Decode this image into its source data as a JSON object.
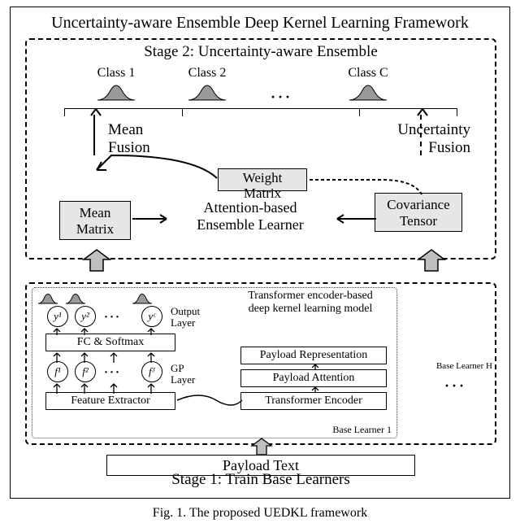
{
  "title": "Uncertainty-aware Ensemble Deep Kernel Learning Framework",
  "stage2": {
    "title": "Stage 2: Uncertainty-aware Ensemble",
    "classes": {
      "c1": "Class 1",
      "c2": "Class 2",
      "cC": "Class C",
      "dots": "···"
    },
    "mean_fusion": "Mean\nFusion",
    "uncertainty_fusion": "Uncertainty\nFusion",
    "weight_matrix_l1": "Weight",
    "weight_matrix_l2": "Matrix",
    "mean_matrix_l1": "Mean",
    "mean_matrix_l2": "Matrix",
    "cov_tensor_l1": "Covariance",
    "cov_tensor_l2": "Tensor",
    "ael_l1": "Attention-based",
    "ael_l2": "Ensemble Learner"
  },
  "stage1": {
    "title": "Stage 1: Train Base Learners",
    "enc_title_l1": "Transformer encoder-based",
    "enc_title_l2": "deep kernel learning model",
    "output_layer": "Output\nLayer",
    "gp_layer": "GP\nLayer",
    "fc_softmax": "FC & Softmax",
    "feature_extractor": "Feature Extractor",
    "payload_rep": "Payload Representation",
    "payload_attn": "Payload Attention",
    "transformer_enc": "Transformer Encoder",
    "base_learner_1": "Base Learner  1",
    "base_learner_H": "Base Learner  H",
    "dots": "···",
    "payload_text": "Payload Text",
    "nodes_y": {
      "y1": "y¹",
      "y2": "y²",
      "yC": "yᶜ"
    },
    "nodes_f": {
      "f1": "f¹",
      "f2": "f²",
      "fJ": "fᴶ"
    }
  },
  "caption": "Fig. 1. The proposed UEDKL framework"
}
